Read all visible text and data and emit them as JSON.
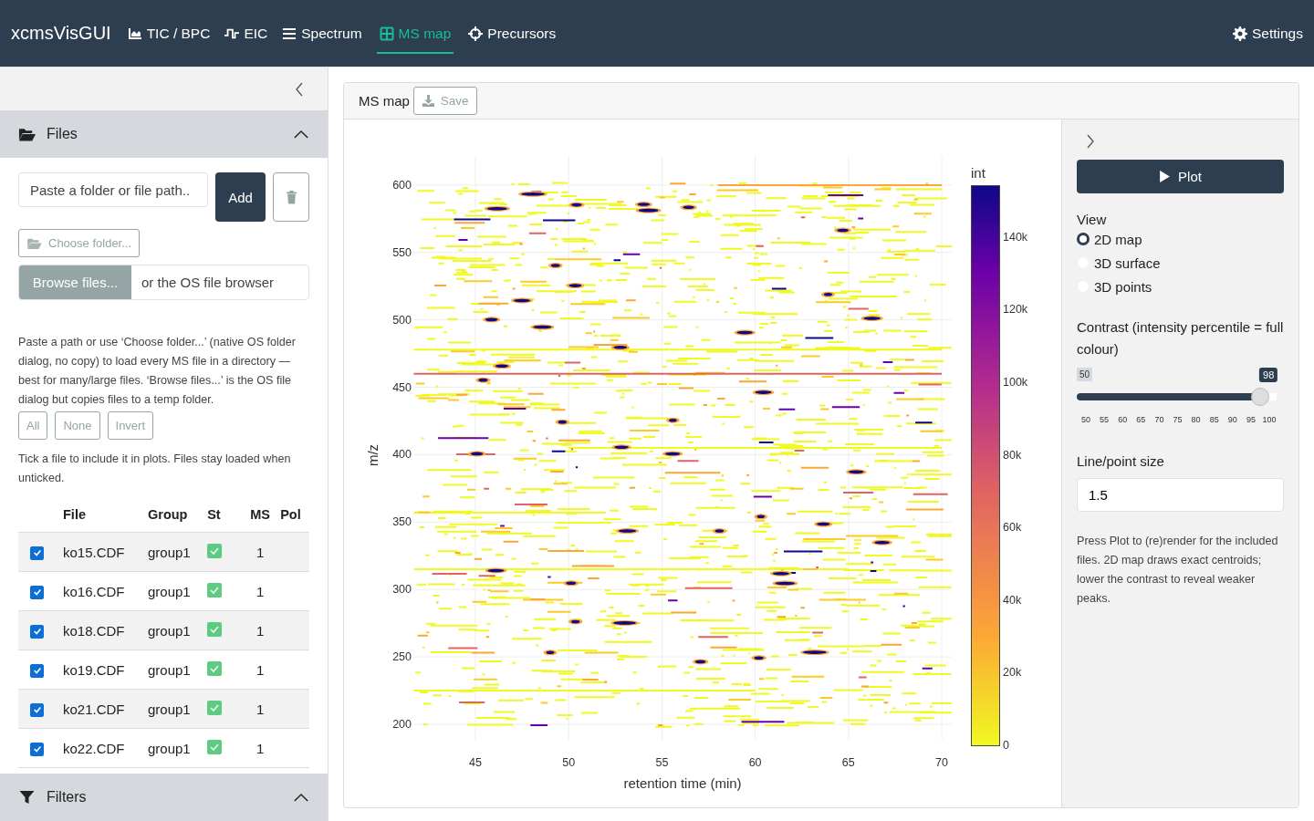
{
  "navbar": {
    "brand": "xcmsVisGUI",
    "tabs": [
      {
        "label": "TIC / BPC",
        "selected": false
      },
      {
        "label": "EIC",
        "selected": false
      },
      {
        "label": "Spectrum",
        "selected": false
      },
      {
        "label": "MS map",
        "selected": true
      },
      {
        "label": "Precursors",
        "selected": false
      }
    ],
    "settings": "Settings"
  },
  "sidebar": {
    "files": {
      "title": "Files",
      "expanded": true,
      "path_placeholder": "Paste a folder or file path..",
      "add": "Add",
      "choose_folder": "Choose folder...",
      "browse": "Browse files...",
      "browse_hint": "or the OS file browser",
      "help": "Paste a path or use ‘Choose folder...’ (native OS folder dialog, no copy) to load every MS file in a directory — best for many/large files. ‘Browse files...’ is the OS file dialog but copies files to a temp folder.",
      "select_buttons": [
        "All",
        "None",
        "Invert"
      ],
      "tick_note": "Tick a file to include it in plots. Files stay loaded when unticked.",
      "columns": [
        "File",
        "Group",
        "St",
        "MS",
        "Pol"
      ],
      "rows": [
        {
          "checked": true,
          "file": "ko15.CDF",
          "group": "group1",
          "status_ok": true,
          "ms": "1"
        },
        {
          "checked": true,
          "file": "ko16.CDF",
          "group": "group1",
          "status_ok": true,
          "ms": "1"
        },
        {
          "checked": true,
          "file": "ko18.CDF",
          "group": "group1",
          "status_ok": true,
          "ms": "1"
        },
        {
          "checked": true,
          "file": "ko19.CDF",
          "group": "group1",
          "status_ok": true,
          "ms": "1"
        },
        {
          "checked": true,
          "file": "ko21.CDF",
          "group": "group1",
          "status_ok": true,
          "ms": "1"
        },
        {
          "checked": true,
          "file": "ko22.CDF",
          "group": "group1",
          "status_ok": true,
          "ms": "1"
        }
      ]
    },
    "filters": {
      "title": "Filters",
      "expanded": true
    }
  },
  "card": {
    "title": "MS map",
    "save": "Save",
    "plot": {
      "ylabel": "m/z",
      "xlabel": "retention time (min)",
      "yticks": [
        "600",
        "550",
        "500",
        "450",
        "400",
        "350",
        "300",
        "250",
        "200"
      ],
      "xticks": [
        "45",
        "50",
        "55",
        "60",
        "65",
        "70"
      ],
      "colorbar_title": "int",
      "colorbar_ticks": [
        "140k",
        "120k",
        "100k",
        "80k",
        "60k",
        "40k",
        "20k",
        "0"
      ]
    },
    "controls": {
      "plot": "Plot",
      "view_label": "View",
      "views": [
        {
          "label": "2D map",
          "selected": true
        },
        {
          "label": "3D surface",
          "selected": false
        },
        {
          "label": "3D points",
          "selected": false
        }
      ],
      "contrast_label": "Contrast (intensity percentile = full colour)",
      "contrast": {
        "min": "50",
        "value": "98",
        "level": 0.96,
        "ticks": [
          "50",
          "55",
          "60",
          "65",
          "70",
          "75",
          "80",
          "85",
          "90",
          "95",
          "100"
        ]
      },
      "size_label": "Line/point size",
      "size_value": "1.5",
      "help": "Press Plot to (re)render for the included files. 2D map draws exact centroids; lower the contrast to reveal weaker peaks."
    }
  }
}
